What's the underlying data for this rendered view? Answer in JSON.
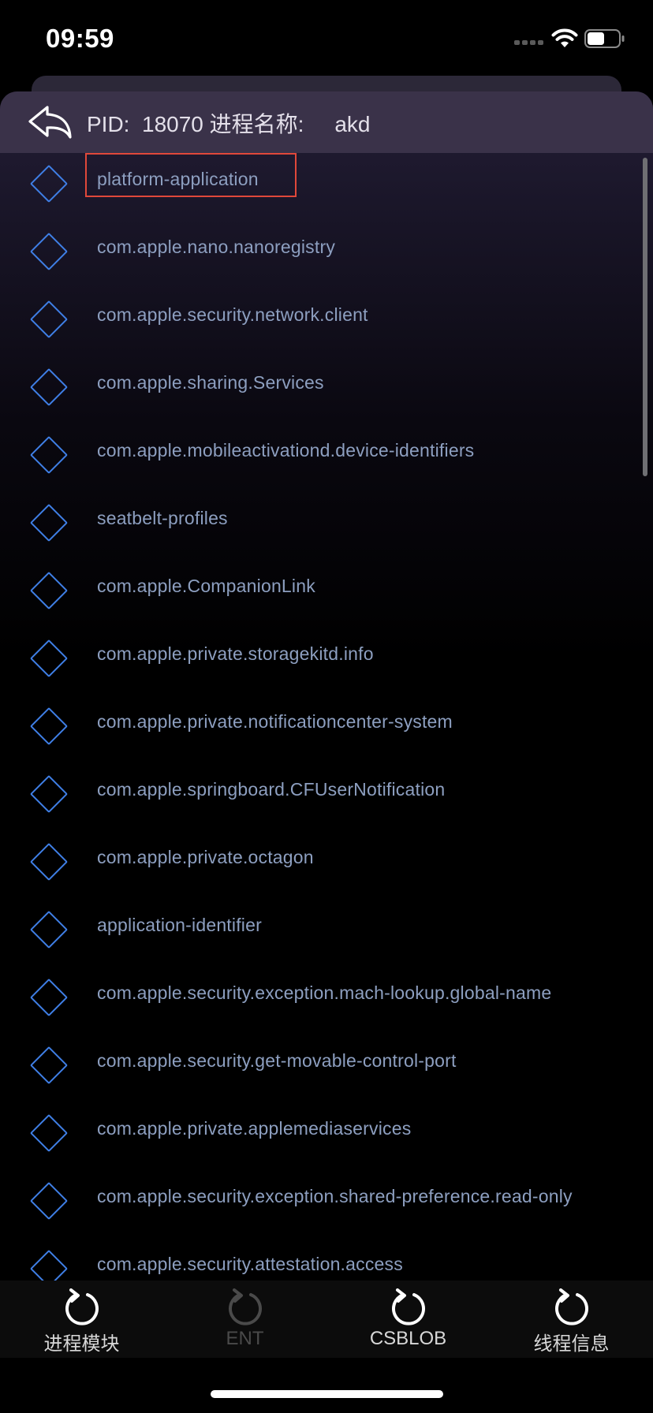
{
  "status_bar": {
    "time": "09:59"
  },
  "header": {
    "title": "PID:  18070 进程名称:     akd"
  },
  "entitlements": [
    "platform-application",
    "com.apple.nano.nanoregistry",
    "com.apple.security.network.client",
    "com.apple.sharing.Services",
    "com.apple.mobileactivationd.device-identifiers",
    "seatbelt-profiles",
    "com.apple.CompanionLink",
    "com.apple.private.storagekitd.info",
    "com.apple.private.notificationcenter-system",
    "com.apple.springboard.CFUserNotification",
    "com.apple.private.octagon",
    "application-identifier",
    "com.apple.security.exception.mach-lookup.global-name",
    "com.apple.security.get-movable-control-port",
    "com.apple.private.applemediaservices",
    "com.apple.security.exception.shared-preference.read-only",
    "com.apple.security.attestation.access"
  ],
  "tabs": [
    {
      "label": "进程模块",
      "icon": "refresh-icon",
      "enabled": true
    },
    {
      "label": "ENT",
      "icon": "refresh-icon",
      "enabled": false
    },
    {
      "label": "CSBLOB",
      "icon": "refresh-icon",
      "enabled": true
    },
    {
      "label": "线程信息",
      "icon": "refresh-icon",
      "enabled": true
    }
  ],
  "colors": {
    "accent": "#3f7fe6",
    "highlight_box": "#e0483a",
    "item_text": "#8d9fc0"
  }
}
